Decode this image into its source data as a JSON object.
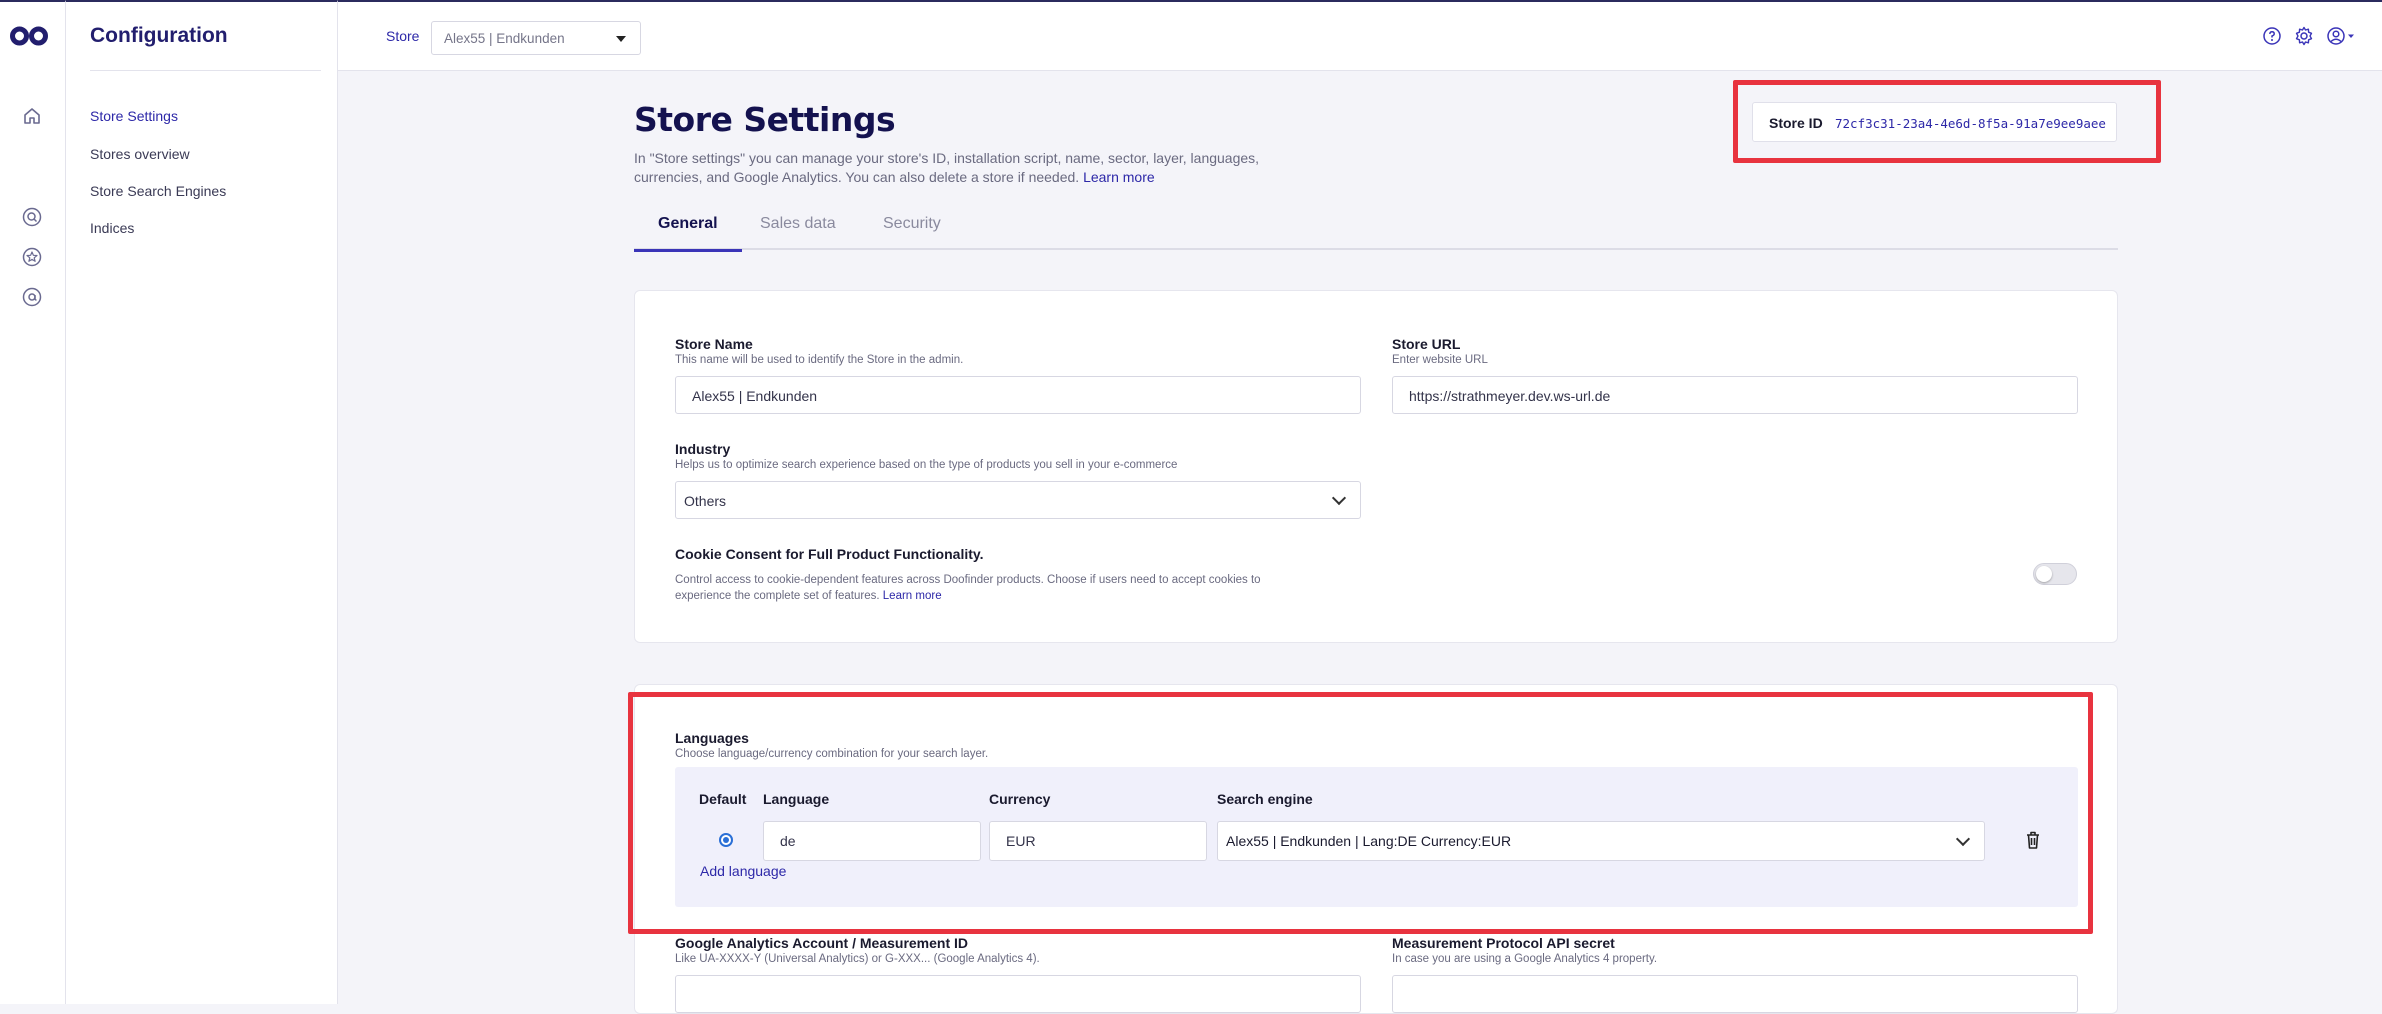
{
  "sidebar": {
    "title": "Configuration",
    "items": [
      {
        "label": "Store Settings"
      },
      {
        "label": "Stores overview"
      },
      {
        "label": "Store Search Engines"
      },
      {
        "label": "Indices"
      }
    ]
  },
  "topbar": {
    "store_label": "Store",
    "store_value": "Alex55 | Endkunden"
  },
  "page": {
    "title": "Store Settings",
    "description": "In \"Store settings\" you can manage your store's ID, installation script, name, sector, layer, languages, currencies, and Google Analytics. You can also delete a store if needed.",
    "learn_more": "Learn more",
    "store_id_label": "Store ID",
    "store_id_value": "72cf3c31-23a4-4e6d-8f5a-91a7e9ee9aee"
  },
  "tabs": [
    {
      "label": "General",
      "active": true
    },
    {
      "label": "Sales data",
      "active": false
    },
    {
      "label": "Security",
      "active": false
    }
  ],
  "general": {
    "store_name_label": "Store Name",
    "store_name_help": "This name will be used to identify the Store in the admin.",
    "store_name_value": "Alex55 | Endkunden",
    "store_url_label": "Store URL",
    "store_url_help": "Enter website URL",
    "store_url_value": "https://strathmeyer.dev.ws-url.de",
    "industry_label": "Industry",
    "industry_help": "Helps us to optimize search experience based on the type of products you sell in your e-commerce",
    "industry_value": "Others",
    "cookie_label": "Cookie Consent for Full Product Functionality.",
    "cookie_help": "Control access to cookie-dependent features across Doofinder products. Choose if users need to accept cookies to experience the complete set of features.",
    "cookie_learn_more": "Learn more",
    "cookie_enabled": false
  },
  "languages": {
    "title": "Languages",
    "help": "Choose language/currency combination for your search layer.",
    "columns": {
      "default": "Default",
      "language": "Language",
      "currency": "Currency",
      "search_engine": "Search engine"
    },
    "rows": [
      {
        "language": "de",
        "currency": "EUR",
        "search_engine": "Alex55 | Endkunden | Lang:DE Currency:EUR",
        "default": true
      }
    ],
    "add_label": "Add language"
  },
  "analytics": {
    "ga_label": "Google Analytics Account / Measurement ID",
    "ga_help": "Like UA-XXXX-Y (Universal Analytics) or G-XXX... (Google Analytics 4).",
    "mp_label": "Measurement Protocol API secret",
    "mp_help": "In case you are using a Google Analytics 4 property."
  },
  "colors": {
    "accent": "#2d28a8",
    "highlight": "#e8333f",
    "brand": "#221e6e"
  },
  "icons": [
    "doofinder-logo-icon",
    "home-icon",
    "search-icon",
    "star-icon",
    "at-icon",
    "help-icon",
    "gear-icon",
    "user-icon",
    "chevron-down-icon",
    "trash-icon"
  ]
}
